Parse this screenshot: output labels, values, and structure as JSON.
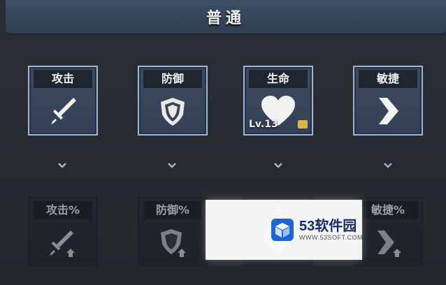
{
  "header": {
    "title": "普通"
  },
  "skills_top": [
    {
      "label": "攻击",
      "icon": "sword-icon"
    },
    {
      "label": "防御",
      "icon": "shield-icon"
    },
    {
      "label": "生命",
      "icon": "heart-icon",
      "level": "Lv.13"
    },
    {
      "label": "敏捷",
      "icon": "chevron-right-icon"
    }
  ],
  "skills_bottom": [
    {
      "label": "攻击%",
      "icon": "sword-up-icon"
    },
    {
      "label": "防御%",
      "icon": "shield-up-icon"
    },
    {
      "label": "生",
      "icon": "heart-up-icon"
    },
    {
      "label": "敏捷%",
      "icon": "chevron-up-icon"
    }
  ],
  "watermark": {
    "name": "53软件园",
    "url": "WWW.53SOFT.COM"
  },
  "colors": {
    "header": "#3d4f66",
    "active_border": "#9fb6d6",
    "locked_border": "#1c2128"
  }
}
